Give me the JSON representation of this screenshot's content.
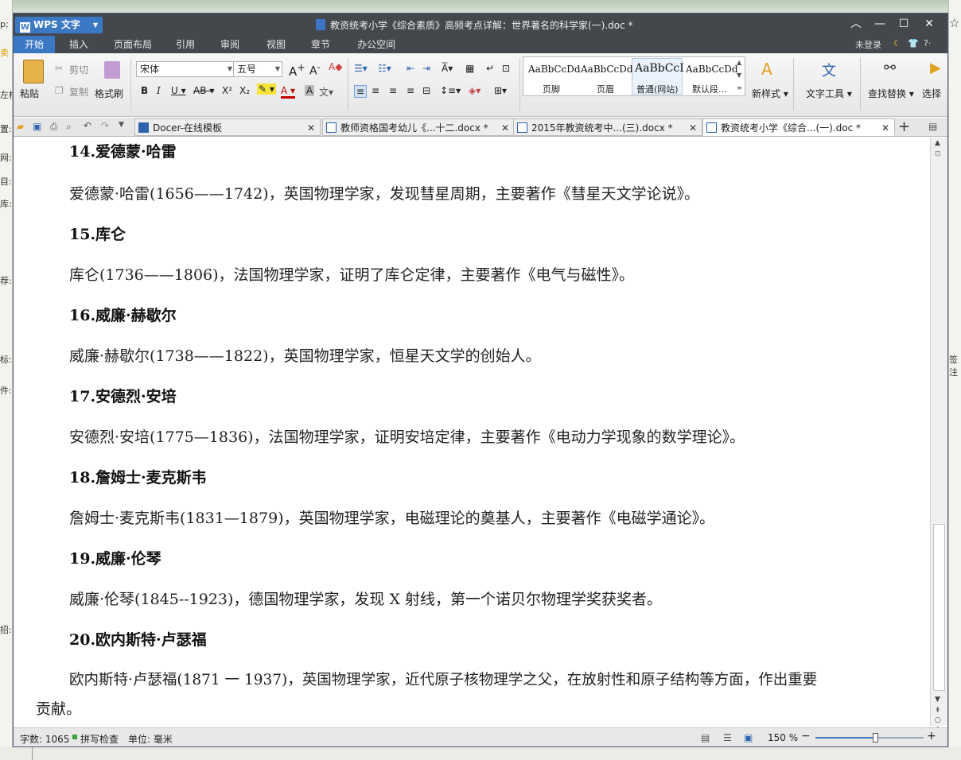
{
  "background": {
    "left_fragments": [
      "p;",
      "卖",
      "左栏",
      "置:",
      "网:",
      "目:",
      "库:",
      "荐:",
      "标:",
      "件:",
      "招:"
    ],
    "right_fragments": [
      "☆",
      "签注"
    ]
  },
  "window": {
    "app_button": "WPS 文字",
    "title": "教资统考小学《综合素质》高频考点详解：世界著名的科学家(一).doc *"
  },
  "menu": {
    "tabs": [
      "开始",
      "插入",
      "页面布局",
      "引用",
      "审阅",
      "视图",
      "章节",
      "办公空间"
    ],
    "active_tab": "开始",
    "login": "未登录"
  },
  "ribbon": {
    "paste": "粘贴",
    "cut": "剪切",
    "copy": "复制",
    "format_painter": "格式刷",
    "font_name": "宋体",
    "font_size": "五号",
    "styles": [
      {
        "sample": "AaBbCcDd",
        "name": "页脚"
      },
      {
        "sample": "AaBbCcDd",
        "name": "页眉"
      },
      {
        "sample": "AaBbCcI",
        "name": "普通(网站)"
      },
      {
        "sample": "AaBbCcDd",
        "name": "默认段..."
      }
    ],
    "new_style": "新样式",
    "text_tools": "文字工具",
    "find_replace": "查找替换",
    "select": "选择"
  },
  "tabs": [
    {
      "label": "Docer-在线模板",
      "active": false
    },
    {
      "label": "教师资格国考幼儿《...十二.docx *",
      "active": false
    },
    {
      "label": "2015年教资统考中...(三).docx *",
      "active": false
    },
    {
      "label": "教资统考小学《综合...(一).doc *",
      "active": true
    }
  ],
  "document": {
    "lines": [
      {
        "type": "heading",
        "text": "14.爱德蒙·哈雷"
      },
      {
        "type": "body",
        "text": "爱德蒙·哈雷(1656——1742)，英国物理学家，发现彗星周期，主要著作《彗星天文学论说》。"
      },
      {
        "type": "heading",
        "text": "15.库仑"
      },
      {
        "type": "body",
        "text": "库仑(1736——1806)，法国物理学家，证明了库仑定律，主要著作《电气与磁性》。"
      },
      {
        "type": "heading",
        "text": "16.威廉·赫歇尔"
      },
      {
        "type": "body",
        "text": "威廉·赫歇尔(1738——1822)，英国物理学家，恒星天文学的创始人。"
      },
      {
        "type": "heading",
        "text": "17.安德烈·安培"
      },
      {
        "type": "body",
        "text": "安德烈·安培(1775—1836)，法国物理学家，证明安培定律，主要著作《电动力学现象的数学理论》。"
      },
      {
        "type": "heading",
        "text": "18.詹姆士·麦克斯韦"
      },
      {
        "type": "body",
        "text": "詹姆士·麦克斯韦(1831—1879)，英国物理学家，电磁理论的奠基人，主要著作《电磁学通论》。"
      },
      {
        "type": "heading",
        "text": "19.威廉·伦琴"
      },
      {
        "type": "body",
        "text": "威廉·伦琴(1845--1923)，德国物理学家，发现 X 射线，第一个诺贝尔物理学奖获奖者。"
      },
      {
        "type": "heading",
        "text": "20.欧内斯特·卢瑟福"
      },
      {
        "type": "body",
        "text": "欧内斯特·卢瑟福(1871 一 1937)，英国物理学家，近代原子核物理学之父，在放射性和原子结构等方面，作出重要"
      },
      {
        "type": "body-cont",
        "text": "贡献。"
      }
    ]
  },
  "status": {
    "word_count": "字数: 1065",
    "spell_check": "拼写检查",
    "unit": "单位: 毫米",
    "zoom": "150 %",
    "zoom_level_fraction": 0.55
  },
  "colors": {
    "accent": "#3b78c4",
    "titlebar": "#44474c"
  }
}
